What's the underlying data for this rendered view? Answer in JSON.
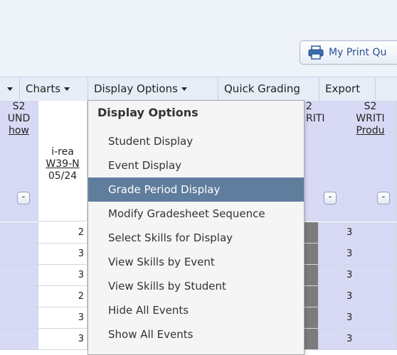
{
  "toolbar": {
    "print_label": "My Print Qu"
  },
  "menubar": {
    "items": [
      {
        "label": "Charts",
        "caret": true
      },
      {
        "label": "Display Options",
        "caret": true
      },
      {
        "label": "Quick Grading",
        "caret": false
      },
      {
        "label": "Export",
        "caret": false
      }
    ]
  },
  "grid": {
    "col1_header": [
      "S2",
      "UND",
      "how"
    ],
    "col2_header": [
      "i-rea",
      "W39-N",
      "05/24"
    ],
    "col4_header": [
      "2",
      "RITI"
    ],
    "col5_header": [
      "S2",
      "WRITI",
      "Produ"
    ],
    "col2_values": [
      "2",
      "3",
      "3",
      "2",
      "3",
      "3"
    ],
    "col5_values": [
      "3",
      "3",
      "3",
      "3",
      "3",
      "3"
    ],
    "minus_label": "-"
  },
  "dropdown": {
    "title": "Display Options",
    "items": [
      "Student Display",
      "Event Display",
      "Grade Period Display",
      "Modify Gradesheet Sequence",
      "Select Skills for Display",
      "View Skills by Event",
      "View Skills by Student",
      "Hide All Events",
      "Show All Events"
    ],
    "active_item": "Grade Period Display"
  },
  "colors": {
    "highlight": "#5f7d9c",
    "purple_cell": "#d8d9f4"
  }
}
